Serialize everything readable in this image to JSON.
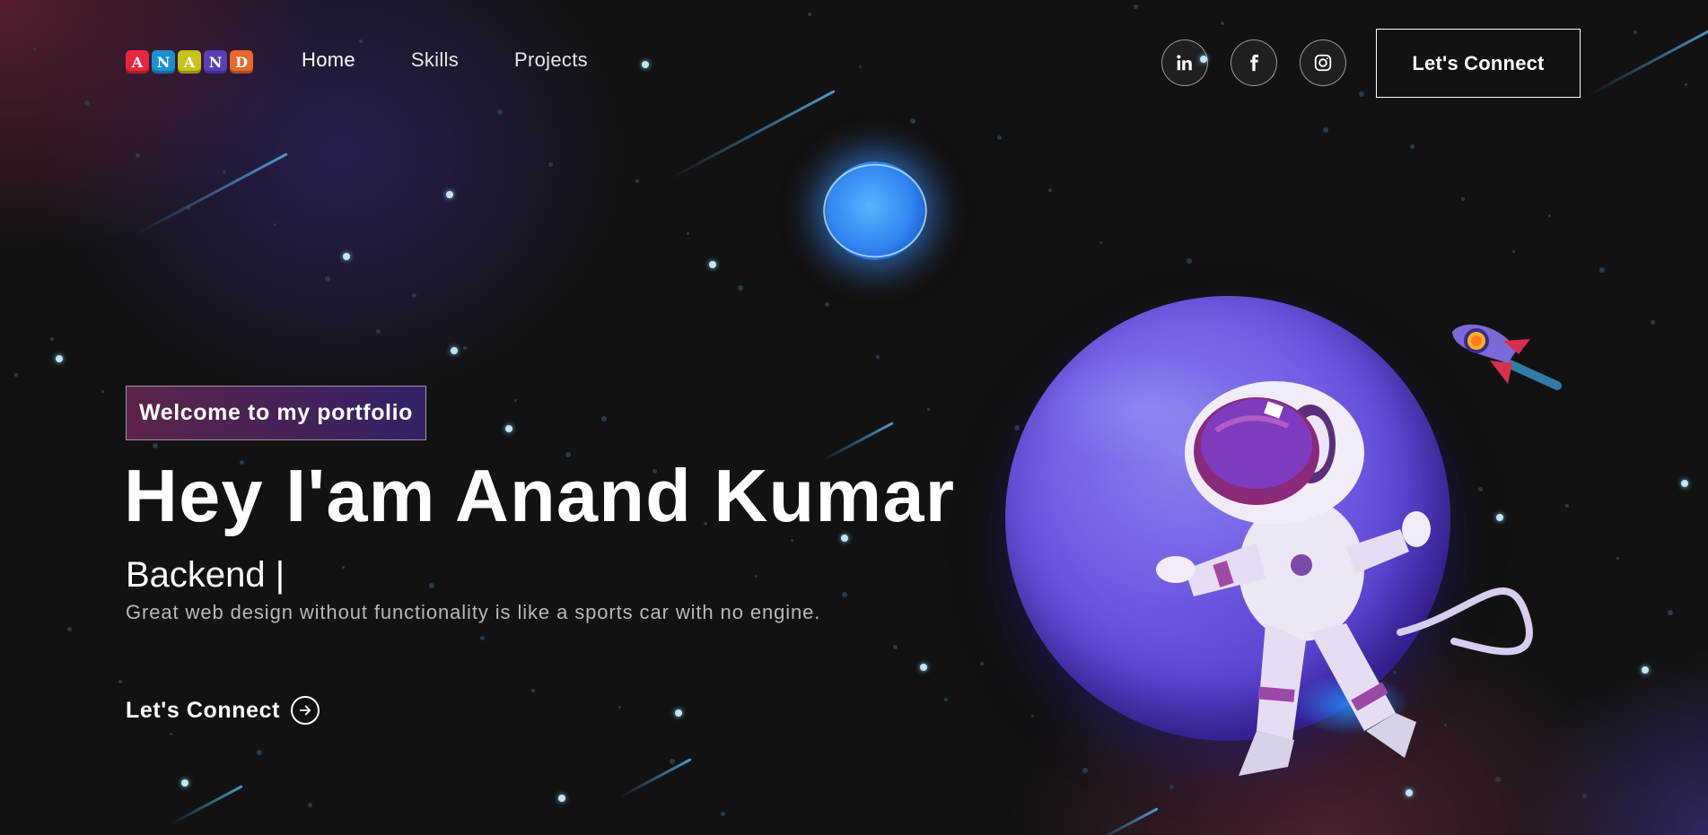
{
  "brand": {
    "logo_letters": [
      {
        "char": "A",
        "color": "#e8263d"
      },
      {
        "char": "N",
        "color": "#1b8fd6"
      },
      {
        "char": "A",
        "color": "#c9c21a"
      },
      {
        "char": "N",
        "color": "#5a3fb8"
      },
      {
        "char": "D",
        "color": "#e8692a"
      }
    ]
  },
  "nav": {
    "links": [
      "Home",
      "Skills",
      "Projects"
    ],
    "active": "Home",
    "socials": [
      "linkedin-icon",
      "facebook-icon",
      "instagram-icon"
    ],
    "connect_label": "Let's Connect"
  },
  "hero": {
    "tagline": "Welcome to my portfolio",
    "headline": "Hey I'am Anand Kumar",
    "typed_text": "Backend |",
    "quote": "Great web design without functionality is like a sports car with no engine.",
    "cta_label": "Let's Connect"
  },
  "colors": {
    "background": "#121212",
    "tagline_gradient_start": "#aa367c",
    "tagline_gradient_end": "#4a2fbd",
    "planet": "#6a56e0",
    "orb": "#2f86ef"
  }
}
